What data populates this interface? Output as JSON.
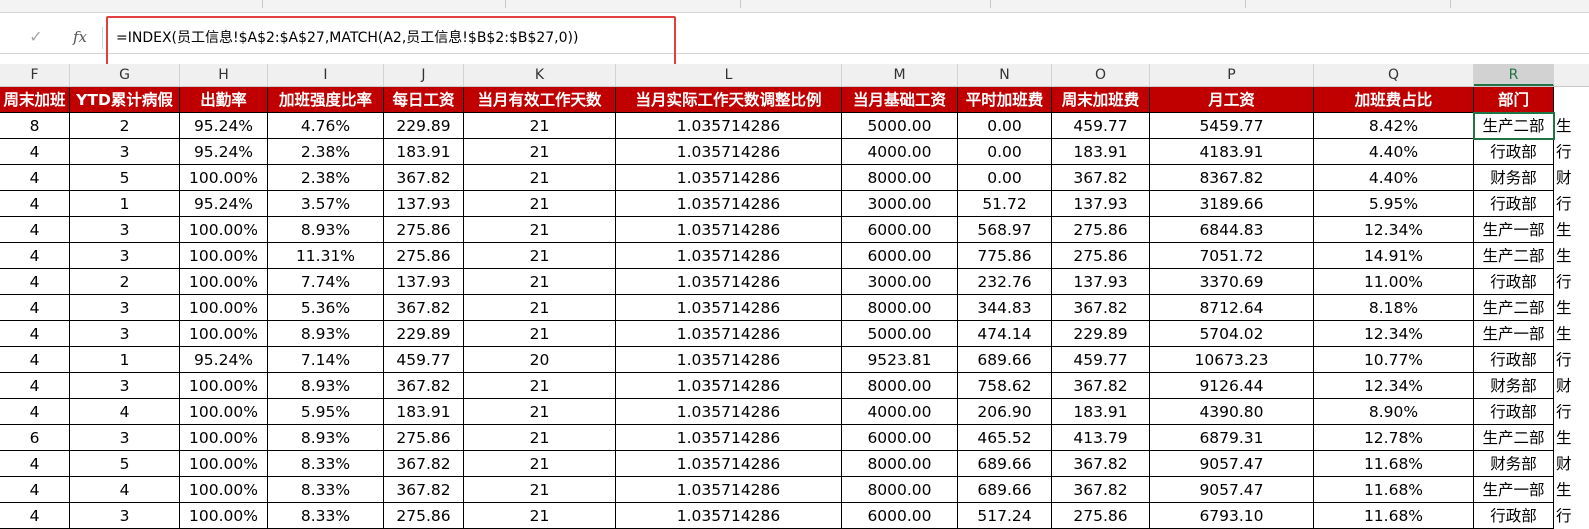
{
  "formula_bar": {
    "cancel_glyph": "✓",
    "fx_label": "fx",
    "formula": "=INDEX(员工信息!$A$2:$A$27,MATCH(A2,员工信息!$B$2:$B$27,0))"
  },
  "columns": [
    {
      "letter": "F"
    },
    {
      "letter": "G"
    },
    {
      "letter": "H"
    },
    {
      "letter": "I"
    },
    {
      "letter": "J"
    },
    {
      "letter": "K"
    },
    {
      "letter": "L"
    },
    {
      "letter": "M"
    },
    {
      "letter": "N"
    },
    {
      "letter": "O"
    },
    {
      "letter": "P"
    },
    {
      "letter": "Q"
    },
    {
      "letter": "R"
    }
  ],
  "selected_column": "R",
  "table": {
    "headers": [
      "周末加班",
      "YTD累计病假",
      "出勤率",
      "加班强度比率",
      "每日工资",
      "当月有效工作天数",
      "当月实际工作天数调整比例",
      "当月基础工资",
      "平时加班费",
      "周末加班费",
      "月工资",
      "加班费占比",
      "部门"
    ],
    "rows": [
      [
        "8",
        "2",
        "95.24%",
        "4.76%",
        "229.89",
        "21",
        "1.035714286",
        "5000.00",
        "0.00",
        "459.77",
        "5459.77",
        "8.42%",
        "生产二部"
      ],
      [
        "4",
        "3",
        "95.24%",
        "2.38%",
        "183.91",
        "21",
        "1.035714286",
        "4000.00",
        "0.00",
        "183.91",
        "4183.91",
        "4.40%",
        "行政部"
      ],
      [
        "4",
        "5",
        "100.00%",
        "2.38%",
        "367.82",
        "21",
        "1.035714286",
        "8000.00",
        "0.00",
        "367.82",
        "8367.82",
        "4.40%",
        "财务部"
      ],
      [
        "4",
        "1",
        "95.24%",
        "3.57%",
        "137.93",
        "21",
        "1.035714286",
        "3000.00",
        "51.72",
        "137.93",
        "3189.66",
        "5.95%",
        "行政部"
      ],
      [
        "4",
        "3",
        "100.00%",
        "8.93%",
        "275.86",
        "21",
        "1.035714286",
        "6000.00",
        "568.97",
        "275.86",
        "6844.83",
        "12.34%",
        "生产一部"
      ],
      [
        "4",
        "3",
        "100.00%",
        "11.31%",
        "275.86",
        "21",
        "1.035714286",
        "6000.00",
        "775.86",
        "275.86",
        "7051.72",
        "14.91%",
        "生产二部"
      ],
      [
        "4",
        "2",
        "100.00%",
        "7.74%",
        "137.93",
        "21",
        "1.035714286",
        "3000.00",
        "232.76",
        "137.93",
        "3370.69",
        "11.00%",
        "行政部"
      ],
      [
        "4",
        "3",
        "100.00%",
        "5.36%",
        "367.82",
        "21",
        "1.035714286",
        "8000.00",
        "344.83",
        "367.82",
        "8712.64",
        "8.18%",
        "生产二部"
      ],
      [
        "4",
        "3",
        "100.00%",
        "8.93%",
        "229.89",
        "21",
        "1.035714286",
        "5000.00",
        "474.14",
        "229.89",
        "5704.02",
        "12.34%",
        "生产一部"
      ],
      [
        "4",
        "1",
        "95.24%",
        "7.14%",
        "459.77",
        "20",
        "1.035714286",
        "9523.81",
        "689.66",
        "459.77",
        "10673.23",
        "10.77%",
        "行政部"
      ],
      [
        "4",
        "3",
        "100.00%",
        "8.93%",
        "367.82",
        "21",
        "1.035714286",
        "8000.00",
        "758.62",
        "367.82",
        "9126.44",
        "12.34%",
        "财务部"
      ],
      [
        "4",
        "4",
        "100.00%",
        "5.95%",
        "183.91",
        "21",
        "1.035714286",
        "4000.00",
        "206.90",
        "183.91",
        "4390.80",
        "8.90%",
        "行政部"
      ],
      [
        "6",
        "3",
        "100.00%",
        "8.93%",
        "275.86",
        "21",
        "1.035714286",
        "6000.00",
        "465.52",
        "413.79",
        "6879.31",
        "12.78%",
        "生产二部"
      ],
      [
        "4",
        "5",
        "100.00%",
        "8.33%",
        "367.82",
        "21",
        "1.035714286",
        "8000.00",
        "689.66",
        "367.82",
        "9057.47",
        "11.68%",
        "财务部"
      ],
      [
        "4",
        "4",
        "100.00%",
        "8.33%",
        "367.82",
        "21",
        "1.035714286",
        "8000.00",
        "689.66",
        "367.82",
        "9057.47",
        "11.68%",
        "生产一部"
      ],
      [
        "4",
        "3",
        "100.00%",
        "8.33%",
        "275.86",
        "21",
        "1.035714286",
        "6000.00",
        "517.24",
        "275.86",
        "6793.10",
        "11.68%",
        "行政部"
      ]
    ],
    "spill_column": [
      "生",
      "行",
      "财",
      "行",
      "生",
      "生",
      "行",
      "生",
      "生",
      "行",
      "财",
      "行",
      "生",
      "财",
      "生",
      "行"
    ]
  }
}
